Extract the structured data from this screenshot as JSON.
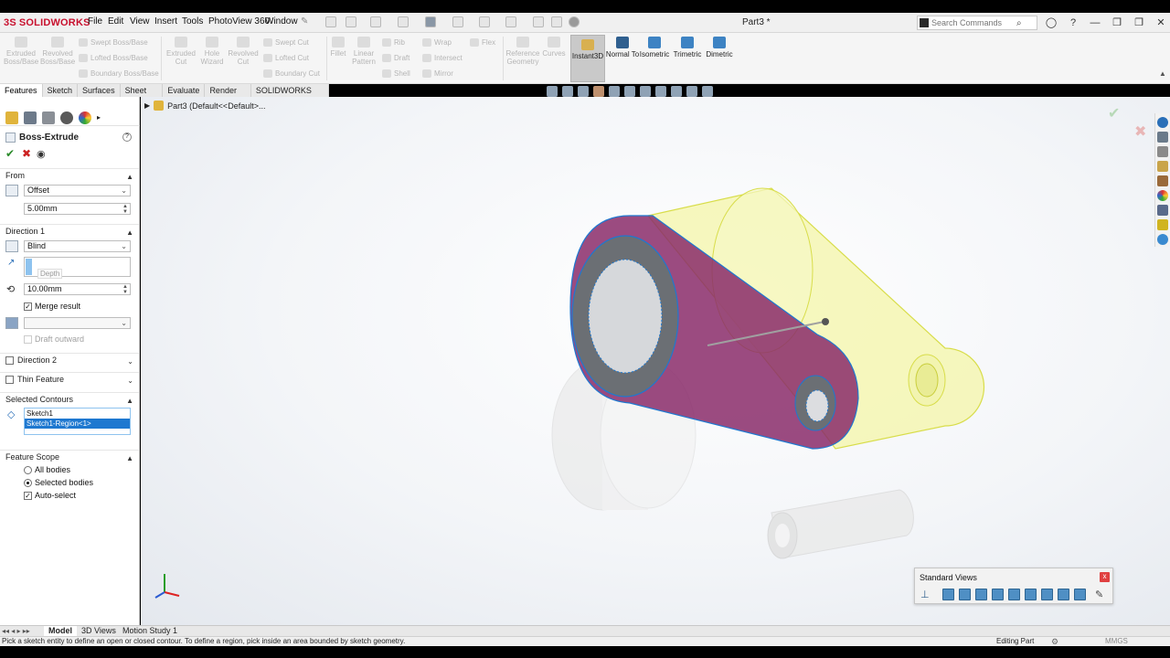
{
  "app": {
    "name": "SOLIDWORKS",
    "doc_title": "Part3 *"
  },
  "menu": [
    "File",
    "Edit",
    "View",
    "Insert",
    "Tools",
    "PhotoView 360",
    "Window"
  ],
  "search": {
    "placeholder": "Search Commands"
  },
  "command_manager": {
    "extruded_boss": "Extruded Boss/Base",
    "revolved_boss": "Revolved Boss/Base",
    "swept_boss": "Swept Boss/Base",
    "lofted_boss": "Lofted Boss/Base",
    "boundary_boss": "Boundary Boss/Base",
    "extruded_cut": "Extruded Cut",
    "hole_wizard": "Hole Wizard",
    "revolved_cut": "Revolved Cut",
    "swept_cut": "Swept Cut",
    "lofted_cut": "Lofted Cut",
    "boundary_cut": "Boundary Cut",
    "fillet": "Fillet",
    "linear_pattern": "Linear Pattern",
    "rib": "Rib",
    "draft": "Draft",
    "shell": "Shell",
    "wrap": "Wrap",
    "intersect": "Intersect",
    "mirror": "Mirror",
    "flex": "Flex",
    "reference_geometry": "Reference Geometry",
    "curves": "Curves",
    "instant3d": "Instant3D",
    "normal_to": "Normal To",
    "isometric": "Isometric",
    "trimetric": "Trimetric",
    "dimetric": "Dimetric"
  },
  "tabs": [
    "Features",
    "Sketch",
    "Surfaces",
    "Sheet Metal",
    "Evaluate",
    "Render Tools",
    "SOLIDWORKS Visualize"
  ],
  "tree": {
    "part_label": "Part3  (Default<<Default>..."
  },
  "property_manager": {
    "title": "Boss-Extrude",
    "from": {
      "header": "From",
      "type": "Offset",
      "offset": "5.00mm"
    },
    "direction1": {
      "header": "Direction 1",
      "type": "Blind",
      "depth_tooltip": "Depth",
      "depth": "10.00mm",
      "merge_label": "Merge result",
      "draft_label": "Draft outward"
    },
    "direction2": {
      "header": "Direction 2"
    },
    "thin_feature": {
      "header": "Thin Feature"
    },
    "contours": {
      "header": "Selected Contours",
      "items": [
        "Sketch1",
        "Sketch1-Region<1>"
      ]
    },
    "feature_scope": {
      "header": "Feature Scope",
      "all_bodies": "All bodies",
      "selected_bodies": "Selected bodies",
      "auto_select": "Auto-select"
    }
  },
  "standard_views": {
    "title": "Standard Views"
  },
  "bottom_tabs": [
    "Model",
    "3D Views",
    "Motion Study 1"
  ],
  "status": {
    "message": "Pick a sketch entity to define an open or closed contour. To define a region, pick inside an area bounded by sketch geometry.",
    "mode": "Editing Part",
    "units": "MMGS"
  },
  "colors": {
    "brand": "#c8102e",
    "preview": "#f4f6a8",
    "face": "#8a2b6a",
    "selection": "#1e78d0"
  }
}
